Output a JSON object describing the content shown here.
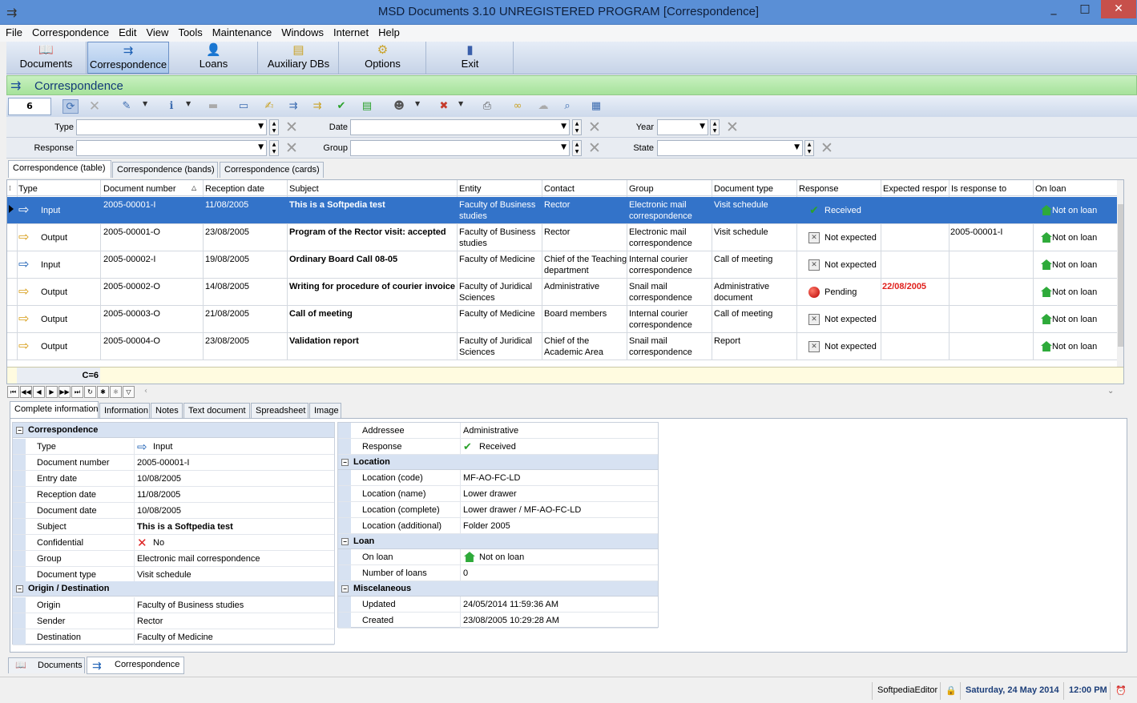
{
  "window": {
    "title": "MSD Documents 3.10 UNREGISTERED PROGRAM [Correspondence]",
    "minimize": "_",
    "maximize": "□",
    "close": "✕"
  },
  "menu": [
    "File",
    "Correspondence",
    "Edit",
    "View",
    "Tools",
    "Maintenance",
    "Windows",
    "Internet",
    "Help"
  ],
  "big_toolbar": [
    {
      "label": "Documents",
      "icon": "book-icon"
    },
    {
      "label": "Correspondence",
      "icon": "correspondence-icon",
      "selected": true
    },
    {
      "label": "Loans",
      "icon": "loans-icon"
    },
    {
      "label": "Auxiliary DBs",
      "icon": "database-icon"
    },
    {
      "label": "Options",
      "icon": "gears-icon"
    },
    {
      "label": "Exit",
      "icon": "door-icon"
    }
  ],
  "section_title": "Correspondence",
  "record_count_box": "6",
  "filters": {
    "type_label": "Type",
    "date_label": "Date",
    "year_label": "Year",
    "response_label": "Response",
    "group_label": "Group",
    "state_label": "State"
  },
  "view_tabs": [
    "Correspondence (table)",
    "Correspondence (bands)",
    "Correspondence (cards)"
  ],
  "grid": {
    "columns": [
      "Type",
      "Document number",
      "Reception date",
      "Subject",
      "Entity",
      "Contact",
      "Group",
      "Document type",
      "Response",
      "Expected respor",
      "Is response to",
      "On loan"
    ],
    "rows": [
      {
        "type": "Input",
        "doc_number": "2005-00001-I",
        "reception": "11/08/2005",
        "subject": "This is a Softpedia test",
        "entity": "Faculty of Business studies",
        "contact": "Rector",
        "group": "Electronic mail correspondence",
        "doc_type": "Visit schedule",
        "response": "Received",
        "response_icon": "check-icon",
        "expected": "",
        "is_response_to": "",
        "on_loan": "Not on loan"
      },
      {
        "type": "Output",
        "doc_number": "2005-00001-O",
        "reception": "23/08/2005",
        "subject": "Program of the Rector visit: accepted",
        "entity": "Faculty of Business studies",
        "contact": "Rector",
        "group": "Electronic mail correspondence",
        "doc_type": "Visit schedule",
        "response": "Not expected",
        "response_icon": "box-x-icon",
        "expected": "",
        "is_response_to": "2005-00001-I",
        "on_loan": "Not on loan"
      },
      {
        "type": "Input",
        "doc_number": "2005-00002-I",
        "reception": "19/08/2005",
        "subject": "Ordinary Board Call 08-05",
        "entity": "Faculty of Medicine",
        "contact": "Chief of the Teaching department",
        "group": "Internal courier correspondence",
        "doc_type": "Call of meeting",
        "response": "Not expected",
        "response_icon": "box-x-icon",
        "expected": "",
        "is_response_to": "",
        "on_loan": "Not on loan"
      },
      {
        "type": "Output",
        "doc_number": "2005-00002-O",
        "reception": "14/08/2005",
        "subject": "Writing for procedure of courier invoice",
        "entity": "Faculty of Juridical Sciences",
        "contact": "Administrative",
        "group": "Snail mail correspondence",
        "doc_type": "Administrative document",
        "response": "Pending",
        "response_icon": "red-dot-icon",
        "expected": "22/08/2005",
        "is_response_to": "",
        "on_loan": "Not on loan"
      },
      {
        "type": "Output",
        "doc_number": "2005-00003-O",
        "reception": "21/08/2005",
        "subject": "Call of meeting",
        "entity": "Faculty of Medicine",
        "contact": "Board members",
        "group": "Internal courier correspondence",
        "doc_type": "Call of meeting",
        "response": "Not expected",
        "response_icon": "box-x-icon",
        "expected": "",
        "is_response_to": "",
        "on_loan": "Not on loan"
      },
      {
        "type": "Output",
        "doc_number": "2005-00004-O",
        "reception": "23/08/2005",
        "subject": "Validation report",
        "entity": "Faculty of Juridical Sciences",
        "contact": "Chief of the Academic Area",
        "group": "Snail mail correspondence",
        "doc_type": "Report",
        "response": "Not expected",
        "response_icon": "box-x-icon",
        "expected": "",
        "is_response_to": "",
        "on_loan": "Not on loan"
      }
    ],
    "footer_count": "C=6",
    "expected_color": "#e0201c"
  },
  "detail_tabs": [
    "Complete information",
    "Information",
    "Notes",
    "Text document",
    "Spreadsheet",
    "Image"
  ],
  "detail": {
    "left": {
      "sec1": "Correspondence",
      "rows1": [
        {
          "k": "Type",
          "v": "Input"
        },
        {
          "k": "Document number",
          "v": "2005-00001-I"
        },
        {
          "k": "Entry date",
          "v": "10/08/2005"
        },
        {
          "k": "Reception date",
          "v": "11/08/2005"
        },
        {
          "k": "Document date",
          "v": "10/08/2005"
        },
        {
          "k": "Subject",
          "v": "This is a Softpedia test"
        },
        {
          "k": "Confidential",
          "v": "No"
        },
        {
          "k": "Group",
          "v": "Electronic mail correspondence"
        },
        {
          "k": "Document type",
          "v": "Visit schedule"
        }
      ],
      "sec2": "Origin / Destination",
      "rows2": [
        {
          "k": "Origin",
          "v": "Faculty of Business studies"
        },
        {
          "k": "Sender",
          "v": "Rector"
        },
        {
          "k": "Destination",
          "v": "Faculty of Medicine"
        }
      ]
    },
    "right": {
      "rows0": [
        {
          "k": "Addressee",
          "v": "Administrative"
        },
        {
          "k": "Response",
          "v": "Received"
        }
      ],
      "sec_location": "Location",
      "rows_location": [
        {
          "k": "Location (code)",
          "v": "MF-AO-FC-LD"
        },
        {
          "k": "Location (name)",
          "v": "Lower drawer"
        },
        {
          "k": "Location (complete)",
          "v": "Lower drawer / MF-AO-FC-LD"
        },
        {
          "k": "Location (additional)",
          "v": "Folder 2005"
        }
      ],
      "sec_loan": "Loan",
      "rows_loan": [
        {
          "k": "On loan",
          "v": "Not on loan"
        },
        {
          "k": "Number of loans",
          "v": "0"
        }
      ],
      "sec_misc": "Miscelaneous",
      "rows_misc": [
        {
          "k": "Updated",
          "v": "24/05/2014 11:59:36 AM"
        },
        {
          "k": "Created",
          "v": "23/08/2005 10:29:28 AM"
        }
      ]
    }
  },
  "bottom_tabs": [
    "Documents",
    "Correspondence"
  ],
  "status": {
    "user": "SoftpediaEditor",
    "date": "Saturday, 24 May 2014",
    "time": "12:00 PM"
  }
}
